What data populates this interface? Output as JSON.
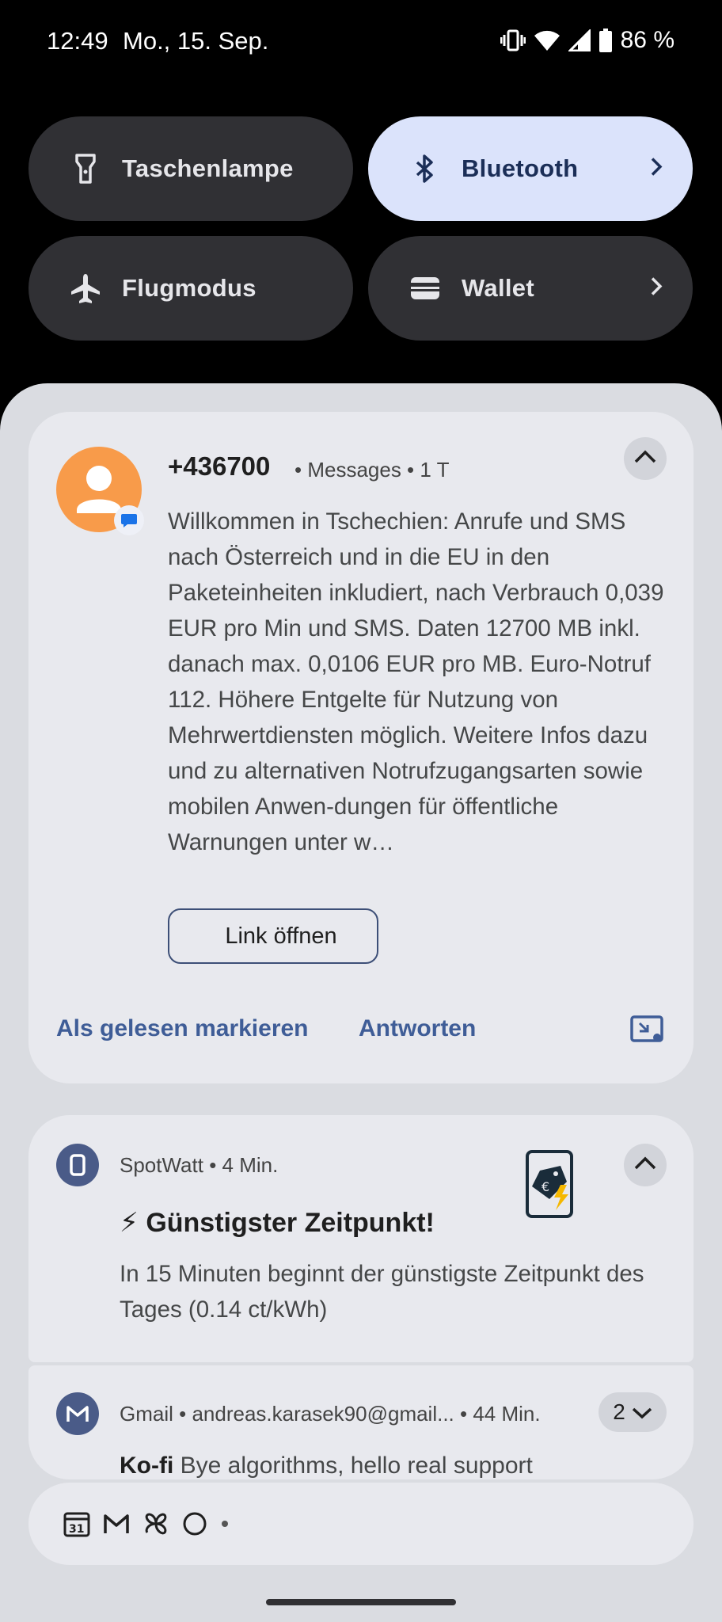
{
  "status_bar": {
    "time": "12:49",
    "date": "Mo., 15. Sep.",
    "battery": "86 %",
    "icons": [
      "vibrate-icon",
      "wifi-icon",
      "cell-signal-icon",
      "battery-icon"
    ]
  },
  "quick_tiles": [
    {
      "label": "Taschenlampe",
      "icon": "flashlight-icon",
      "active": false
    },
    {
      "label": "Bluetooth",
      "icon": "bluetooth-icon",
      "active": true
    },
    {
      "label": "Flugmodus",
      "icon": "airplane-icon",
      "active": false
    },
    {
      "label": "Wallet",
      "icon": "wallet-icon",
      "active": false
    }
  ],
  "notifications": {
    "message": {
      "sender": "+436700",
      "meta": "• Messages • 1 T",
      "body": "Willkommen in Tschechien: Anrufe und SMS nach Österreich und in die EU in den Paketeinheiten inkludiert, nach Verbrauch 0,039 EUR pro Min und SMS. Daten 12700 MB inkl. danach max. 0,0106 EUR pro MB. Euro-Notruf 112. Höhere Entgelte für Nutzung von Mehrwertdiensten möglich. Weitere Infos dazu und zu alternativen Notrufzugangsarten sowie mobilen Anwen-dungen für öffentliche Warnungen unter w…",
      "link_button": "Link öffnen",
      "action_read": "Als gelesen markieren",
      "action_reply": "Antworten"
    },
    "spotwatt": {
      "meta": "SpotWatt • 4 Min.",
      "title": "⚡ Günstigster Zeitpunkt!",
      "text": "In 15 Minuten beginnt der günstigste Zeitpunkt des Tages (0.14 ct/kWh)"
    },
    "gmail": {
      "meta": "Gmail • andreas.karasek90@gmail... • 44 Min.",
      "count": "2",
      "subject_sender": "Ko-fi",
      "subject_text": "Bye algorithms, hello real support"
    }
  },
  "shelf": {
    "calendar_day": "31",
    "icons": [
      "calendar-icon",
      "gmail-icon",
      "pinwheel-icon",
      "circle-icon",
      "dot-icon"
    ]
  },
  "colors": {
    "shade_bg": "#dadce1",
    "card_bg": "#e8e9ee",
    "tile_bg": "#303034",
    "tile_active_bg": "#dbe3fb",
    "accent": "#3f5d97",
    "avatar": "#f89b4a"
  }
}
